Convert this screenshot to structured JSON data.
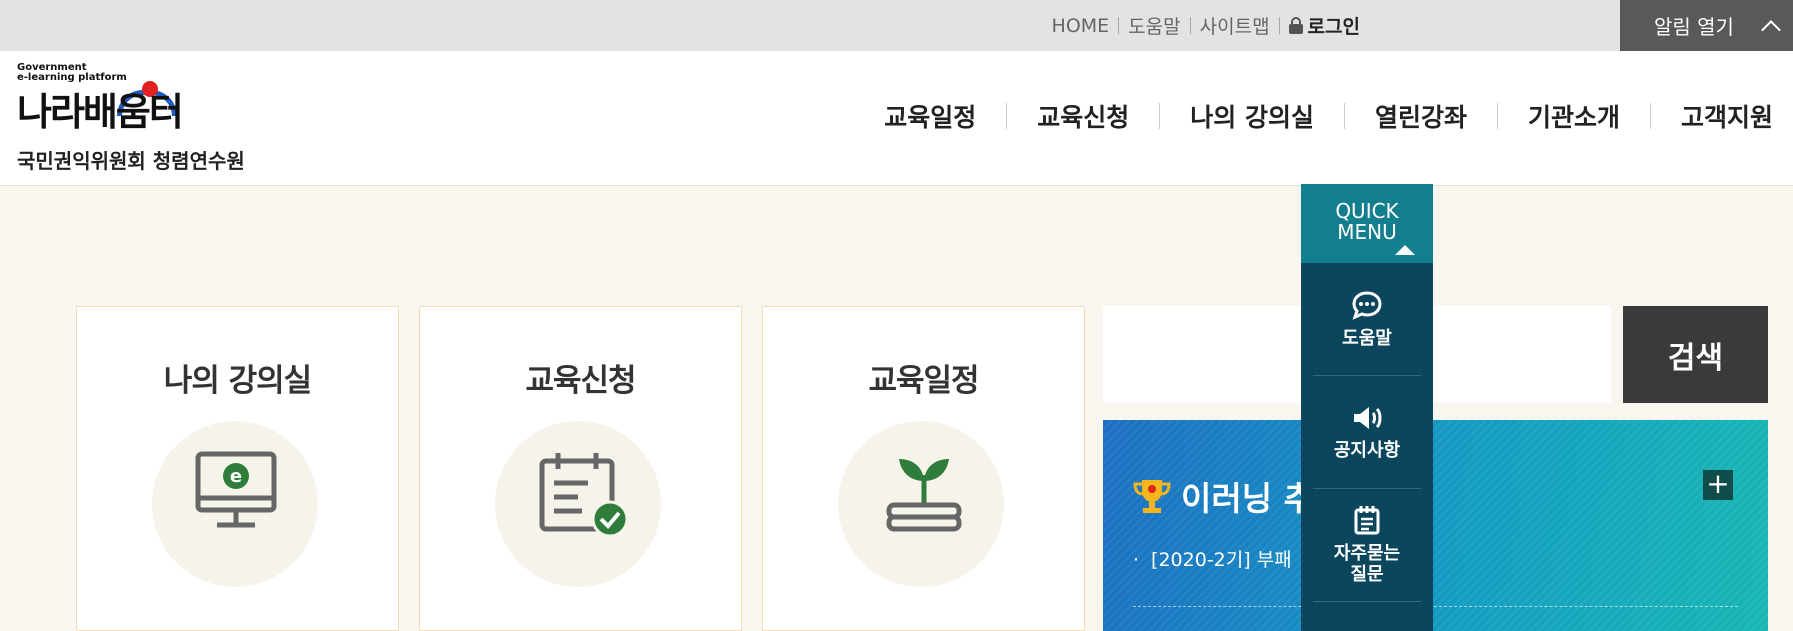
{
  "topbar": {
    "home": "HOME",
    "help": "도움말",
    "sitemap": "사이트맵",
    "login": "로그인",
    "alarm": "알림 열기"
  },
  "logo": {
    "small1": "Government",
    "small2": "e-learning platform",
    "main": "나라배움터",
    "subtitle": "국민권익위원회 청렴연수원"
  },
  "nav": [
    "교육일정",
    "교육신청",
    "나의 강의실",
    "열린강좌",
    "기관소개",
    "고객지원"
  ],
  "cards": [
    {
      "title": "나의 강의실",
      "icon": "monitor-e-icon"
    },
    {
      "title": "교육신청",
      "icon": "calendar-check-icon"
    },
    {
      "title": "교육일정",
      "icon": "sprout-book-icon"
    }
  ],
  "search": {
    "placeholder": "",
    "button": "검색"
  },
  "board": {
    "title": "이러닝 추",
    "notice": "[2020-2기] 부패",
    "plus": "+"
  },
  "quickmenu": {
    "header_line1": "QUICK",
    "header_line2": "MENU",
    "items": [
      {
        "label": "도움말",
        "icon": "chat-bubble-icon"
      },
      {
        "label": "공지사항",
        "icon": "speaker-icon"
      },
      {
        "label_line1": "자주묻는",
        "label_line2": "질문",
        "icon": "notepad-icon"
      }
    ]
  },
  "colors": {
    "topbar": "#e3e3e3",
    "alarm": "#595959",
    "quick_header": "#137e8d",
    "quick_body": "#0b465c",
    "board_teal": "#149dc2",
    "icon_green": "#2e7d3b"
  }
}
